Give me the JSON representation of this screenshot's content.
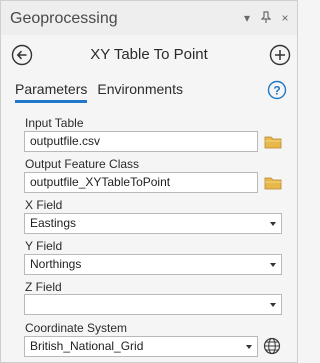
{
  "pane": {
    "title": "Geoprocessing",
    "options_glyph": "▾",
    "pin_glyph": "⊥",
    "close_glyph": "×"
  },
  "tool": {
    "title": "XY Table To Point"
  },
  "tabs": [
    {
      "label": "Parameters",
      "active": true
    },
    {
      "label": "Environments",
      "active": false
    }
  ],
  "params": {
    "input_table": {
      "label": "Input Table",
      "value": "outputfile.csv"
    },
    "output_fc": {
      "label": "Output Feature Class",
      "value": "outputfile_XYTableToPoint"
    },
    "x_field": {
      "label": "X Field",
      "value": "Eastings"
    },
    "y_field": {
      "label": "Y Field",
      "value": "Northings"
    },
    "z_field": {
      "label": "Z Field",
      "value": ""
    },
    "coord_sys": {
      "label": "Coordinate System",
      "value": "British_National_Grid"
    }
  },
  "colors": {
    "accent": "#1f78c8",
    "folder": "#e8b84a"
  },
  "icons": [
    "back-arrow-icon",
    "add-icon",
    "help-icon",
    "folder-icon",
    "globe-icon"
  ]
}
